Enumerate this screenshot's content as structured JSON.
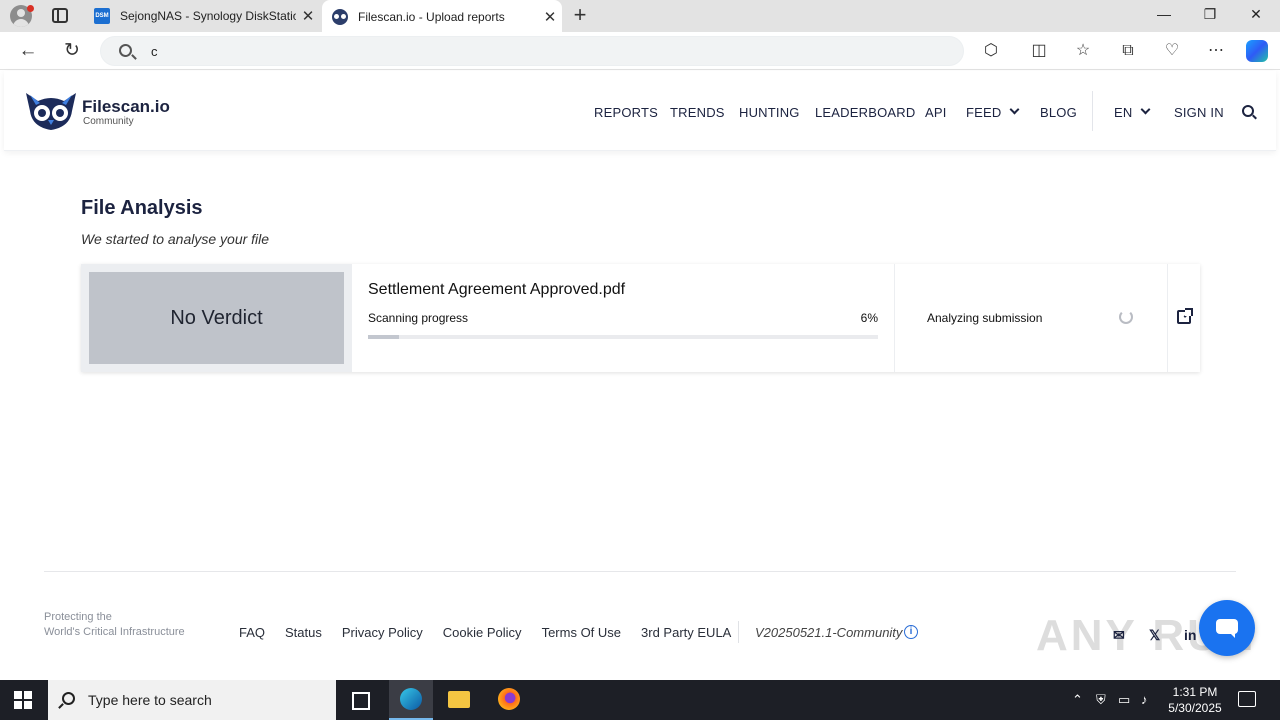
{
  "browser": {
    "tabs": [
      {
        "favicon": "DSM",
        "title": "SejongNAS - Synology DiskStatio",
        "close": "✕"
      },
      {
        "favicon": "owl",
        "title": "Filescan.io - Upload reports",
        "close": "✕"
      }
    ],
    "new_tab": "+",
    "window": {
      "minimize": "—",
      "restore": "❐",
      "close": "✕"
    },
    "address": {
      "value": "c"
    },
    "nav_icons": {
      "back": "←",
      "refresh": "↻"
    },
    "toolbar_icons": [
      "extensions-icon",
      "split-screen-icon",
      "favorites-icon",
      "collections-icon",
      "browser-essentials-icon",
      "more-icon"
    ]
  },
  "site": {
    "logo": {
      "name": "Filescan.io",
      "sub": "Community"
    },
    "nav": {
      "reports": "REPORTS",
      "trends": "TRENDS",
      "hunting": "HUNTING",
      "leaderboard": "LEADERBOARD",
      "api": "API",
      "feed": "FEED",
      "blog": "BLOG",
      "lang": "EN",
      "signin": "SIGN IN"
    }
  },
  "analysis": {
    "title": "File Analysis",
    "subtitle": "We started to analyse your file",
    "verdict": "No Verdict",
    "file_name": "Settlement Agreement Approved.pdf",
    "progress_label": "Scanning progress",
    "progress_text": "6%",
    "progress_value": 0.06,
    "status": "Analyzing submission"
  },
  "footer": {
    "tagline_1": "Protecting the",
    "tagline_2": "World's Critical Infrastructure",
    "links": [
      "FAQ",
      "Status",
      "Privacy Policy",
      "Cookie Policy",
      "Terms Of Use",
      "3rd Party EULA"
    ],
    "version": "V20250521.1-Community",
    "info": "i",
    "social_x": "𝕏"
  },
  "watermark": "ANY RUN",
  "taskbar": {
    "search_placeholder": "Type here to search",
    "time": "1:31 PM",
    "date": "5/30/2025",
    "tray_up": "⌃"
  },
  "colors": {
    "brand": "#1c2340",
    "accent": "#1a73f0",
    "verdict_bg": "#bfc3ca"
  }
}
